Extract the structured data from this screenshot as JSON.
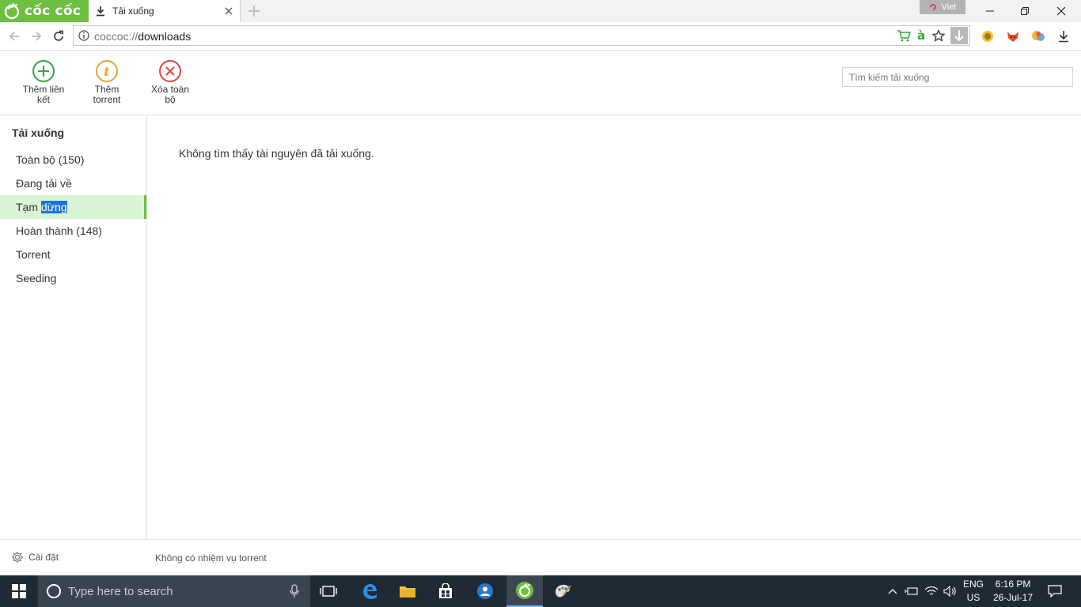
{
  "browser": {
    "brand": "cốc cốc",
    "tab_title": "Tải xuống",
    "lang_badge": "Viet",
    "url_scheme": "coccoc://",
    "url_path": "downloads"
  },
  "toolbar": {
    "add_link": "Thêm liên kết",
    "add_torrent": "Thêm torrent",
    "delete_all": "Xóa toàn bộ",
    "search_placeholder": "Tìm kiếm tải xuống"
  },
  "sidebar": {
    "title": "Tải xuống",
    "items": [
      {
        "label": "Toàn bộ (150)"
      },
      {
        "label": "Đang tải về"
      },
      {
        "label_plain": "Tạm ",
        "label_selected": "dừng",
        "active": true
      },
      {
        "label": "Hoàn thành (148)"
      },
      {
        "label": "Torrent"
      },
      {
        "label": "Seeding"
      }
    ]
  },
  "main": {
    "empty_message": "Không tìm thấy tài nguyên đã tải xuống."
  },
  "footer": {
    "settings": "Cài đặt",
    "torrent_status": "Không có nhiệm vụ torrent"
  },
  "taskbar": {
    "search_placeholder": "Type here to search",
    "lang_line1": "ENG",
    "lang_line2": "US",
    "time": "6:16 PM",
    "date": "26-Jul-17"
  },
  "colors": {
    "brand_green": "#6cbf3f",
    "active_item_bg": "#d9f5d6",
    "add_icon": "#2ea84a",
    "torrent_icon": "#e8a33a",
    "delete_icon": "#d9463e"
  }
}
